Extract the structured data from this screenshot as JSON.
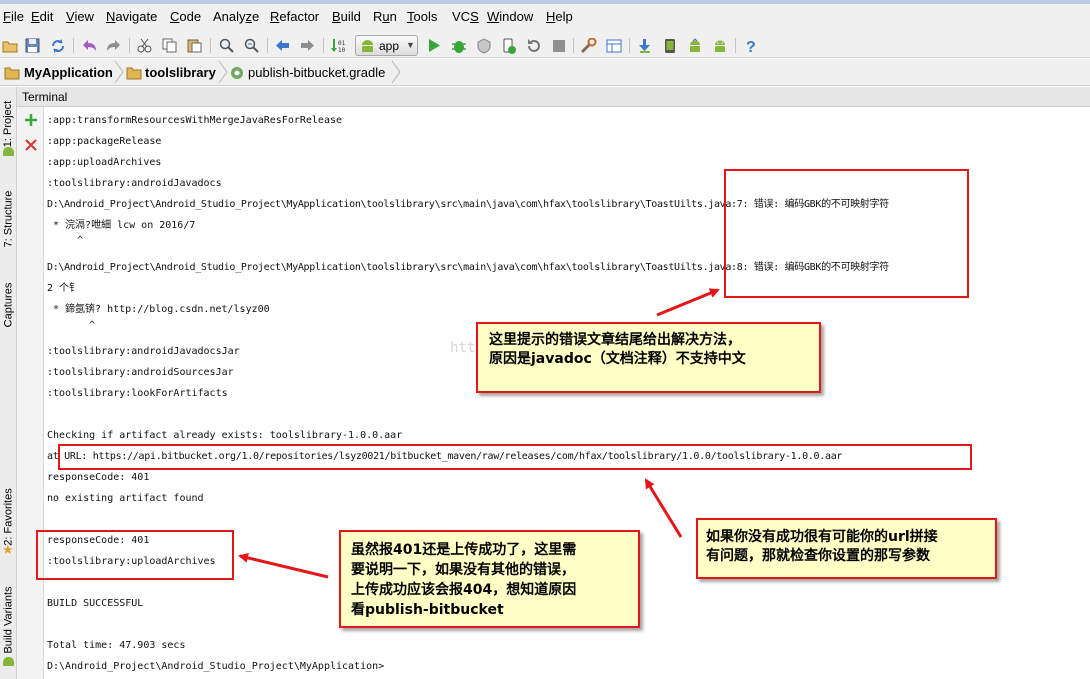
{
  "menu": [
    {
      "label": "File",
      "mnemonic": "F"
    },
    {
      "label": "Edit",
      "mnemonic": "E"
    },
    {
      "label": "View",
      "mnemonic": "V"
    },
    {
      "label": "Navigate",
      "mnemonic": "N"
    },
    {
      "label": "Code",
      "mnemonic": "C"
    },
    {
      "label": "Analyze",
      "mnemonic": "z"
    },
    {
      "label": "Refactor",
      "mnemonic": "R"
    },
    {
      "label": "Build",
      "mnemonic": "B"
    },
    {
      "label": "Run",
      "mnemonic": "u"
    },
    {
      "label": "Tools",
      "mnemonic": "T"
    },
    {
      "label": "VCS",
      "mnemonic": "S"
    },
    {
      "label": "Window",
      "mnemonic": "W"
    },
    {
      "label": "Help",
      "mnemonic": "H"
    }
  ],
  "toolbar": {
    "run_config": "app",
    "icons": [
      "open-folder-icon",
      "save-icon",
      "sync-icon",
      "undo-icon",
      "redo-icon",
      "cut-icon",
      "copy-icon",
      "paste-icon",
      "find-icon",
      "replace-icon",
      "back-icon",
      "forward-icon",
      "make-project-icon",
      "run-icon",
      "debug-icon",
      "coverage-icon",
      "attach-debugger-icon",
      "rerun-icon",
      "stop-icon",
      "project-structure-icon",
      "sdk-manager-icon",
      "avd-manager-icon",
      "gradle-sync-icon",
      "android-monitor-icon",
      "android-icon",
      "help-icon"
    ],
    "colors": {
      "run": "#3aa53a",
      "debug": "#3aa53a",
      "help": "#3b78c9",
      "android": "#86b539"
    }
  },
  "breadcrumb": [
    {
      "label": "MyApplication",
      "icon": "folder-icon",
      "bold": true
    },
    {
      "label": "toolslibrary",
      "icon": "folder-icon",
      "bold": true
    },
    {
      "label": "publish-bitbucket.gradle",
      "icon": "gradle-file-icon",
      "bold": false
    }
  ],
  "sidebar_tabs": [
    "1: Project",
    "7: Structure",
    "Captures",
    "2: Favorites",
    "Build Variants"
  ],
  "terminal": {
    "title": "Terminal",
    "add_icon_color": "#3aa53a",
    "close_icon_color": "#d33c3c",
    "lines": [
      ":app:transformResourcesWithMergeJavaResForRelease",
      ":app:packageRelease",
      ":app:uploadArchives",
      ":toolslibrary:androidJavadocs",
      "D:\\Android_Project\\Android_Studio_Project\\MyApplication\\toolslibrary\\src\\main\\java\\com\\hfax\\toolslibrary\\ToastUilts.java:7: 错误: 编码GBK的不可映射字符",
      " * 浣滆?呭細 lcw on 2016/7",
      "     ^",
      "D:\\Android_Project\\Android_Studio_Project\\MyApplication\\toolslibrary\\src\\main\\java\\com\\hfax\\toolslibrary\\ToastUilts.java:8: 错误: 编码GBK的不可映射字符",
      "2 个钅",
      " * 鍗氬锛? http://blog.csdn.net/lsyz00",
      "       ^",
      ":toolslibrary:androidJavadocsJar",
      ":toolslibrary:androidSourcesJar",
      ":toolslibrary:lookForArtifacts",
      "Checking if artifact already exists: toolslibrary-1.0.0.aar",
      "at URL: https://api.bitbucket.org/1.0/repositories/lsyz0021/bitbucket_maven/raw/releases/com/hfax/toolslibrary/1.0.0/toolslibrary-1.0.0.aar",
      "responseCode: 401",
      "no existing artifact found",
      "responseCode: 401",
      ":toolslibrary:uploadArchives",
      "BUILD SUCCESSFUL",
      "Total time: 47.903 secs",
      "D:\\Android_Project\\Android_Studio_Project\\MyApplication>"
    ]
  },
  "annotations": {
    "note1": [
      "这里提示的错误文章结尾给出解决方法，",
      "原因是javadoc（文档注释）不支持中文"
    ],
    "note2": [
      "如果你没有成功很有可能你的url拼接",
      "有问题，那就检查你设置的那写参数"
    ],
    "note3": [
      "虽然报401还是上传成功了，这里需",
      "要说明一下，如果没有其他的错误，",
      "上传成功应该会报404，想知道原因",
      "看publish-bitbucket"
    ],
    "colors": {
      "border": "#e4161a",
      "fill": "#ffffc6",
      "arrow": "#e4161a"
    }
  },
  "watermark": "http"
}
